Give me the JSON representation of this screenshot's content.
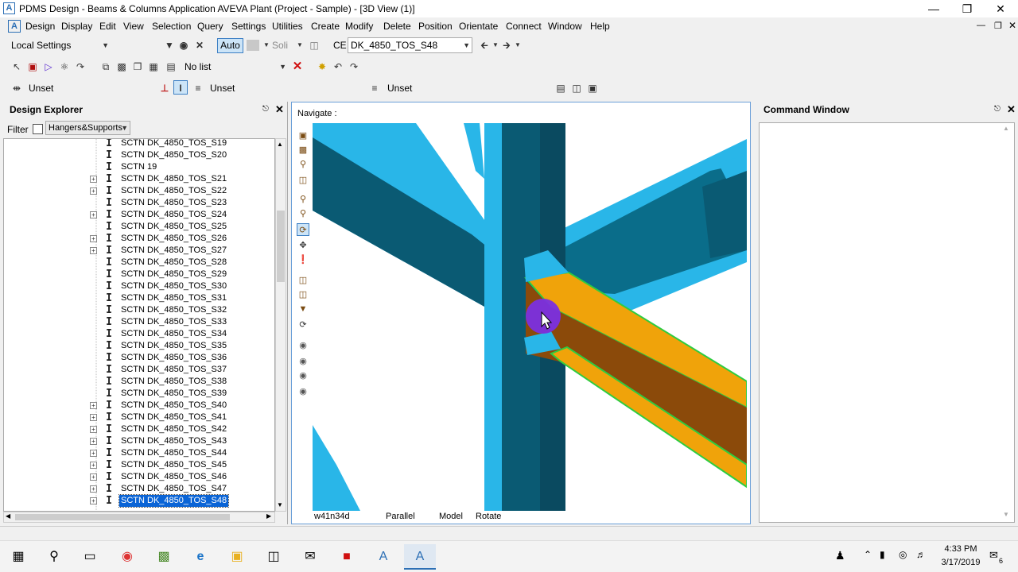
{
  "window": {
    "title": "PDMS Design - Beams & Columns Application  AVEVA Plant (Project - Sample) - [3D View (1)]",
    "app_icon": "A"
  },
  "menu": [
    "Design",
    "Display",
    "Edit",
    "View",
    "Selection",
    "Query",
    "Settings",
    "Utilities",
    "Create",
    "Modify",
    "Delete",
    "Position",
    "Orientate",
    "Connect",
    "Window",
    "Help"
  ],
  "toolbar1": {
    "settings_combo": "Local Settings",
    "auto_label": "Auto",
    "solid_label": "Soli",
    "ce_label": "CE",
    "ce_value": "DK_4850_TOS_S48"
  },
  "toolbar2": {
    "list_combo": "No list"
  },
  "toolbar3": {
    "unset1": "Unset",
    "unset2": "Unset",
    "unset3": "Unset"
  },
  "explorer": {
    "title": "Design Explorer",
    "filter_label": "Filter",
    "filter_value": "Hangers&Supports",
    "items": [
      {
        "label": "SCTN DK_4850_TOS_S19",
        "expand": false
      },
      {
        "label": "SCTN DK_4850_TOS_S20",
        "expand": false
      },
      {
        "label": "SCTN 19",
        "expand": false
      },
      {
        "label": "SCTN DK_4850_TOS_S21",
        "expand": true
      },
      {
        "label": "SCTN DK_4850_TOS_S22",
        "expand": true
      },
      {
        "label": "SCTN DK_4850_TOS_S23",
        "expand": false
      },
      {
        "label": "SCTN DK_4850_TOS_S24",
        "expand": true
      },
      {
        "label": "SCTN DK_4850_TOS_S25",
        "expand": false
      },
      {
        "label": "SCTN DK_4850_TOS_S26",
        "expand": true
      },
      {
        "label": "SCTN DK_4850_TOS_S27",
        "expand": true
      },
      {
        "label": "SCTN DK_4850_TOS_S28",
        "expand": false
      },
      {
        "label": "SCTN DK_4850_TOS_S29",
        "expand": false
      },
      {
        "label": "SCTN DK_4850_TOS_S30",
        "expand": false
      },
      {
        "label": "SCTN DK_4850_TOS_S31",
        "expand": false
      },
      {
        "label": "SCTN DK_4850_TOS_S32",
        "expand": false
      },
      {
        "label": "SCTN DK_4850_TOS_S33",
        "expand": false
      },
      {
        "label": "SCTN DK_4850_TOS_S34",
        "expand": false
      },
      {
        "label": "SCTN DK_4850_TOS_S35",
        "expand": false
      },
      {
        "label": "SCTN DK_4850_TOS_S36",
        "expand": false
      },
      {
        "label": "SCTN DK_4850_TOS_S37",
        "expand": false
      },
      {
        "label": "SCTN DK_4850_TOS_S38",
        "expand": false
      },
      {
        "label": "SCTN DK_4850_TOS_S39",
        "expand": false
      },
      {
        "label": "SCTN DK_4850_TOS_S40",
        "expand": true
      },
      {
        "label": "SCTN DK_4850_TOS_S41",
        "expand": true
      },
      {
        "label": "SCTN DK_4850_TOS_S42",
        "expand": true
      },
      {
        "label": "SCTN DK_4850_TOS_S43",
        "expand": true
      },
      {
        "label": "SCTN DK_4850_TOS_S44",
        "expand": true
      },
      {
        "label": "SCTN DK_4850_TOS_S45",
        "expand": true
      },
      {
        "label": "SCTN DK_4850_TOS_S46",
        "expand": true
      },
      {
        "label": "SCTN DK_4850_TOS_S47",
        "expand": true
      },
      {
        "label": "SCTN DK_4850_TOS_S48",
        "expand": true,
        "selected": true
      }
    ]
  },
  "view3d": {
    "navigate_label": "Navigate :",
    "status": [
      "w41n34d",
      "Parallel",
      "Model",
      "Rotate"
    ]
  },
  "command_window": {
    "title": "Command Window"
  },
  "taskbar": {
    "time": "4:33 PM",
    "date": "3/17/2019",
    "notification_count": "6"
  },
  "colors": {
    "steel_cyan": "#29b6e8",
    "steel_dark": "#0a5a73",
    "beam_orange": "#f0a30a",
    "beam_brown": "#8b4a0a",
    "highlight_green": "#2ecc40",
    "selection_blue": "#0a64d6",
    "cursor_purple": "#7b2fe0"
  }
}
